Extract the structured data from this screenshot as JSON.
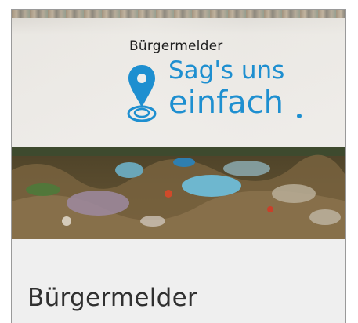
{
  "header": {
    "app_name": "Bürgermelder",
    "slogan_line1": "Sag's uns",
    "slogan_line2": "einfach",
    "brand_color": "#1e8fd0",
    "icon": "location-pin-icon"
  },
  "main": {
    "title": "Bürgermelder"
  }
}
